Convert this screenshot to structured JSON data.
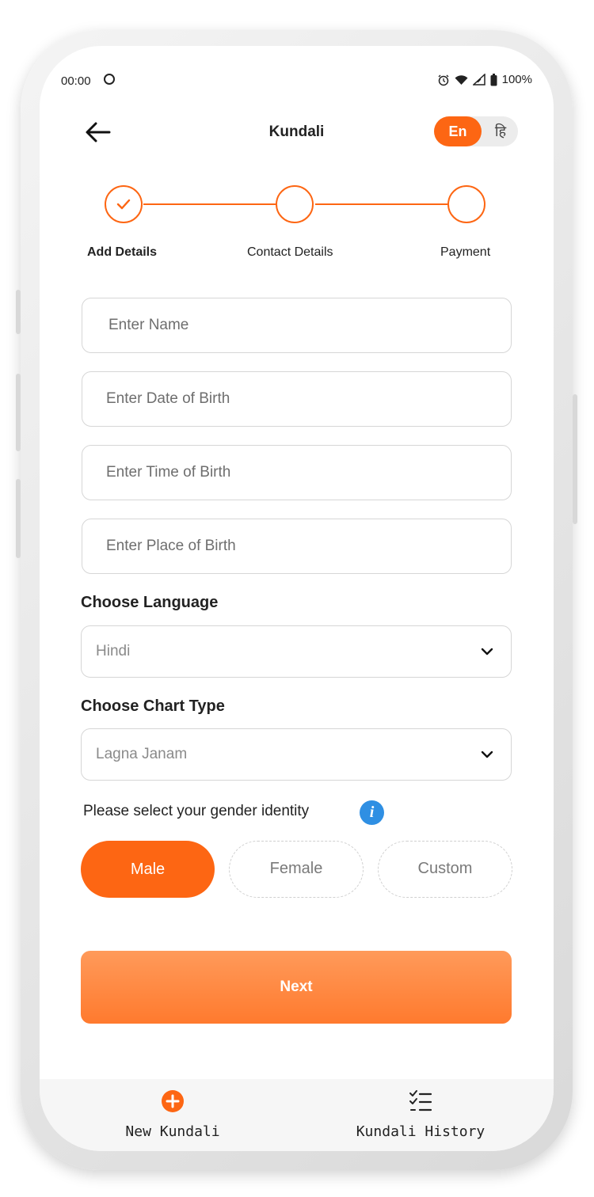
{
  "status_bar": {
    "time": "00:00",
    "battery": "100%"
  },
  "header": {
    "title": "Kundali",
    "lang_en": "En",
    "lang_hi": "हि"
  },
  "steps": [
    {
      "label": "Add Details",
      "state": "completed"
    },
    {
      "label": "Contact Details",
      "state": "pending"
    },
    {
      "label": "Payment",
      "state": "pending"
    }
  ],
  "form": {
    "name_placeholder": "Enter Name",
    "dob_placeholder": "Enter Date of Birth",
    "tob_placeholder": "Enter Time of Birth",
    "pob_placeholder": "Enter Place of Birth",
    "language_label": "Choose Language",
    "language_value": "Hindi",
    "chart_label": "Choose Chart Type",
    "chart_value": "Lagna Janam",
    "gender_question": "Please select your gender identity",
    "info_glyph": "i",
    "genders": [
      "Male",
      "Female",
      "Custom"
    ],
    "selected_gender": "Male",
    "next_label": "Next"
  },
  "bottom_nav": {
    "new": "New Kundali",
    "history": "Kundali History",
    "new_icon": "plus-circle-icon",
    "history_icon": "checklist-icon"
  },
  "colors": {
    "accent": "#fd6613",
    "info": "#2f8fe3"
  }
}
